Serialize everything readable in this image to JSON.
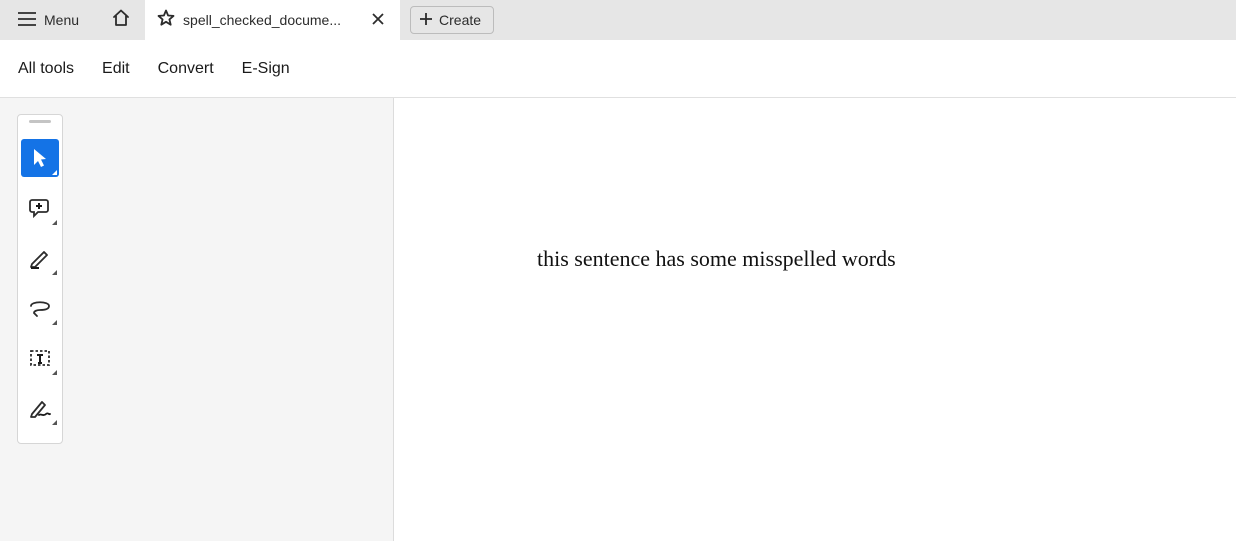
{
  "topbar": {
    "menu_label": "Menu",
    "tab_title": "spell_checked_docume...",
    "create_label": "Create"
  },
  "menubar": {
    "items": [
      "All tools",
      "Edit",
      "Convert",
      "E-Sign"
    ]
  },
  "document": {
    "body_text": "this sentence has some misspelled words"
  },
  "vtoolbar": {
    "tools": [
      {
        "name": "select-tool",
        "active": true
      },
      {
        "name": "comment-tool",
        "active": false
      },
      {
        "name": "highlight-tool",
        "active": false
      },
      {
        "name": "draw-tool",
        "active": false
      },
      {
        "name": "textbox-tool",
        "active": false
      },
      {
        "name": "sign-tool",
        "active": false
      }
    ]
  }
}
